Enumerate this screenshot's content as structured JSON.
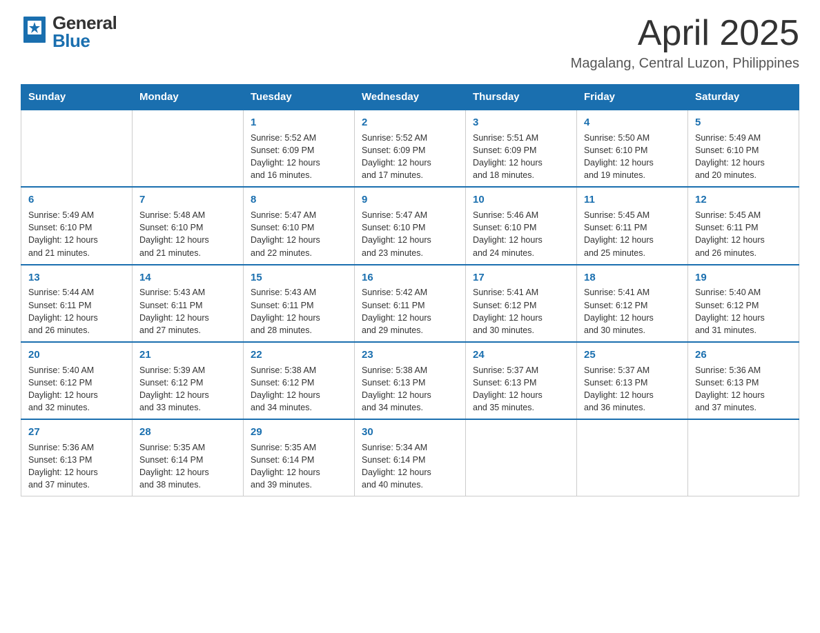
{
  "header": {
    "month_title": "April 2025",
    "subtitle": "Magalang, Central Luzon, Philippines",
    "logo_general": "General",
    "logo_blue": "Blue"
  },
  "weekdays": [
    "Sunday",
    "Monday",
    "Tuesday",
    "Wednesday",
    "Thursday",
    "Friday",
    "Saturday"
  ],
  "weeks": [
    [
      {
        "day": "",
        "info": ""
      },
      {
        "day": "",
        "info": ""
      },
      {
        "day": "1",
        "info": "Sunrise: 5:52 AM\nSunset: 6:09 PM\nDaylight: 12 hours\nand 16 minutes."
      },
      {
        "day": "2",
        "info": "Sunrise: 5:52 AM\nSunset: 6:09 PM\nDaylight: 12 hours\nand 17 minutes."
      },
      {
        "day": "3",
        "info": "Sunrise: 5:51 AM\nSunset: 6:09 PM\nDaylight: 12 hours\nand 18 minutes."
      },
      {
        "day": "4",
        "info": "Sunrise: 5:50 AM\nSunset: 6:10 PM\nDaylight: 12 hours\nand 19 minutes."
      },
      {
        "day": "5",
        "info": "Sunrise: 5:49 AM\nSunset: 6:10 PM\nDaylight: 12 hours\nand 20 minutes."
      }
    ],
    [
      {
        "day": "6",
        "info": "Sunrise: 5:49 AM\nSunset: 6:10 PM\nDaylight: 12 hours\nand 21 minutes."
      },
      {
        "day": "7",
        "info": "Sunrise: 5:48 AM\nSunset: 6:10 PM\nDaylight: 12 hours\nand 21 minutes."
      },
      {
        "day": "8",
        "info": "Sunrise: 5:47 AM\nSunset: 6:10 PM\nDaylight: 12 hours\nand 22 minutes."
      },
      {
        "day": "9",
        "info": "Sunrise: 5:47 AM\nSunset: 6:10 PM\nDaylight: 12 hours\nand 23 minutes."
      },
      {
        "day": "10",
        "info": "Sunrise: 5:46 AM\nSunset: 6:10 PM\nDaylight: 12 hours\nand 24 minutes."
      },
      {
        "day": "11",
        "info": "Sunrise: 5:45 AM\nSunset: 6:11 PM\nDaylight: 12 hours\nand 25 minutes."
      },
      {
        "day": "12",
        "info": "Sunrise: 5:45 AM\nSunset: 6:11 PM\nDaylight: 12 hours\nand 26 minutes."
      }
    ],
    [
      {
        "day": "13",
        "info": "Sunrise: 5:44 AM\nSunset: 6:11 PM\nDaylight: 12 hours\nand 26 minutes."
      },
      {
        "day": "14",
        "info": "Sunrise: 5:43 AM\nSunset: 6:11 PM\nDaylight: 12 hours\nand 27 minutes."
      },
      {
        "day": "15",
        "info": "Sunrise: 5:43 AM\nSunset: 6:11 PM\nDaylight: 12 hours\nand 28 minutes."
      },
      {
        "day": "16",
        "info": "Sunrise: 5:42 AM\nSunset: 6:11 PM\nDaylight: 12 hours\nand 29 minutes."
      },
      {
        "day": "17",
        "info": "Sunrise: 5:41 AM\nSunset: 6:12 PM\nDaylight: 12 hours\nand 30 minutes."
      },
      {
        "day": "18",
        "info": "Sunrise: 5:41 AM\nSunset: 6:12 PM\nDaylight: 12 hours\nand 30 minutes."
      },
      {
        "day": "19",
        "info": "Sunrise: 5:40 AM\nSunset: 6:12 PM\nDaylight: 12 hours\nand 31 minutes."
      }
    ],
    [
      {
        "day": "20",
        "info": "Sunrise: 5:40 AM\nSunset: 6:12 PM\nDaylight: 12 hours\nand 32 minutes."
      },
      {
        "day": "21",
        "info": "Sunrise: 5:39 AM\nSunset: 6:12 PM\nDaylight: 12 hours\nand 33 minutes."
      },
      {
        "day": "22",
        "info": "Sunrise: 5:38 AM\nSunset: 6:12 PM\nDaylight: 12 hours\nand 34 minutes."
      },
      {
        "day": "23",
        "info": "Sunrise: 5:38 AM\nSunset: 6:13 PM\nDaylight: 12 hours\nand 34 minutes."
      },
      {
        "day": "24",
        "info": "Sunrise: 5:37 AM\nSunset: 6:13 PM\nDaylight: 12 hours\nand 35 minutes."
      },
      {
        "day": "25",
        "info": "Sunrise: 5:37 AM\nSunset: 6:13 PM\nDaylight: 12 hours\nand 36 minutes."
      },
      {
        "day": "26",
        "info": "Sunrise: 5:36 AM\nSunset: 6:13 PM\nDaylight: 12 hours\nand 37 minutes."
      }
    ],
    [
      {
        "day": "27",
        "info": "Sunrise: 5:36 AM\nSunset: 6:13 PM\nDaylight: 12 hours\nand 37 minutes."
      },
      {
        "day": "28",
        "info": "Sunrise: 5:35 AM\nSunset: 6:14 PM\nDaylight: 12 hours\nand 38 minutes."
      },
      {
        "day": "29",
        "info": "Sunrise: 5:35 AM\nSunset: 6:14 PM\nDaylight: 12 hours\nand 39 minutes."
      },
      {
        "day": "30",
        "info": "Sunrise: 5:34 AM\nSunset: 6:14 PM\nDaylight: 12 hours\nand 40 minutes."
      },
      {
        "day": "",
        "info": ""
      },
      {
        "day": "",
        "info": ""
      },
      {
        "day": "",
        "info": ""
      }
    ]
  ]
}
